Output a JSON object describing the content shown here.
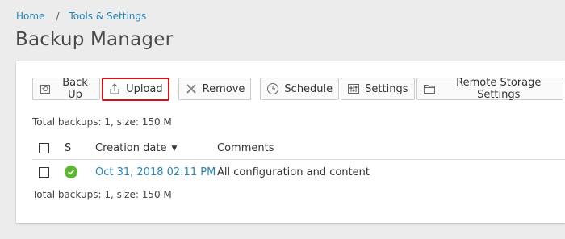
{
  "breadcrumb": {
    "home": "Home",
    "separator": "/",
    "tools": "Tools & Settings"
  },
  "page_title": "Backup Manager",
  "toolbar": {
    "back_up": "Back Up",
    "upload": "Upload",
    "remove": "Remove",
    "schedule": "Schedule",
    "settings": "Settings",
    "remote_storage": "Remote Storage Settings"
  },
  "summary": {
    "top": "Total backups: 1, size: 150 M",
    "bottom": "Total backups: 1, size: 150 M"
  },
  "table": {
    "columns": {
      "status": "S",
      "creation_date": "Creation date",
      "comments": "Comments"
    },
    "rows": [
      {
        "status": "ok",
        "creation_date": "Oct 31, 2018 02:11 PM",
        "comments": "All configuration and content"
      }
    ]
  },
  "colors": {
    "link": "#2785b6",
    "highlight": "#d9101c",
    "status_ok": "#5cb82e"
  }
}
